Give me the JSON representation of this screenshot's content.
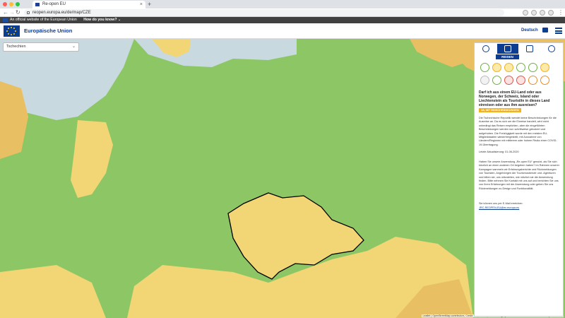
{
  "browser": {
    "tab_title": "Re-open EU",
    "tab_close": "×",
    "new_tab": "+",
    "url": "reopen.europa.eu/de/map/CZE"
  },
  "eubar": {
    "text": "An official website of the European Union",
    "link": "How do you know? ⌄"
  },
  "header": {
    "brand": "Europäische Union",
    "language": "Deutsch"
  },
  "map": {
    "selected_country": "Tschechien",
    "attribution_prefix": "Leaflet | OpenStreetMap contributors, Credit: EU, GISCO, © EuroGeographics for the administrative boundaries |",
    "attribution_link": "Disclaimer",
    "colors": {
      "open": "#8cc665",
      "partial": "#f2d675",
      "closed": "#e8c063",
      "border": "#000000"
    }
  },
  "panel": {
    "active_tab": "REISEN",
    "question": "Darf ich aus einem EU-Land oder aus Norwegen, der Schweiz, Island oder Liechtenstein als Tourist/in in dieses Land einreisen oder aus ihm ausreisen?",
    "badge": "JA, MIT EINSCHRÄNKUNGEN",
    "p1": "Die Tschechische Republik wendet keine Beschränkungen für die Ausreise an. Da es sich um die Einreise handelt, wird nicht unbedingt das Reisen empfohlen, aber die eingeführten Beschränkungen werden nun schrittweise gelockert und aufgehoben. Die Freizügigkeit wurde mit den meisten EU-Mitgliedstaaten wiederhergestellt, mit Ausnahme von Ländern/Regionen mit mittlerem oder hohem Risiko einer COVID-19-Übertragung.",
    "updated": "Letzte Aktualisierung: 01-06-2020",
    "p2": "Haben Sie unsere Anwendung „Re-open EU“ genutzt, als Sie sich kürzlich an einen anderen Ort begeben haben? Im Rahmen unserer Kampagne sammeln wir Erfahrungsberichte und Rückmeldungen von Touristen, Angehörigen der Tourismusberufe und -Agenturen und bitten sie, uns mitzuteilen, wie nützlich sie die Anwendung finden. Bitte nehmen Sie Kontakt mit uns auf und berichten Sie uns von Ihren Erfahrungen mit der Anwendung oder geben Sie uns Rückmeldungen zu Design und Funktionalität.",
    "p3": "Sie können uns per E-Mail erreichen:",
    "email": "JRC-REOPEN-EU@ec.europa.eu"
  }
}
